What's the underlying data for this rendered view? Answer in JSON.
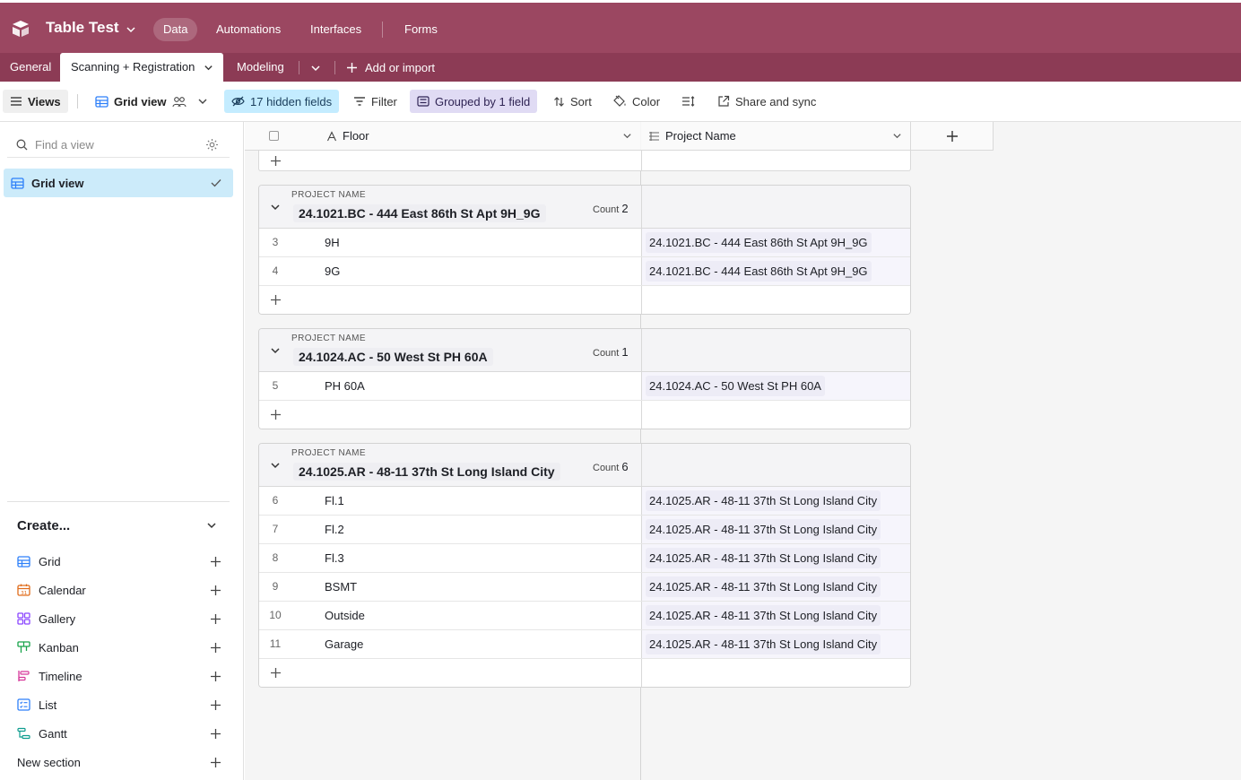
{
  "app": {
    "name": "Table Test"
  },
  "top_nav": [
    "Data",
    "Automations",
    "Interfaces",
    "Forms"
  ],
  "tables": {
    "tabs": [
      "General",
      "Scanning + Registration",
      "Modeling"
    ],
    "add_label": "Add or import"
  },
  "viewbar": {
    "views": "Views",
    "view_name": "Grid view",
    "hidden_fields": "17 hidden fields",
    "filter": "Filter",
    "grouped": "Grouped by 1 field",
    "sort": "Sort",
    "color": "Color",
    "share": "Share and sync"
  },
  "sidebar": {
    "find_placeholder": "Find a view",
    "active_view": "Grid view",
    "create_label": "Create...",
    "create_items": [
      "Grid",
      "Calendar",
      "Gallery",
      "Kanban",
      "Timeline",
      "List",
      "Gantt",
      "New section"
    ],
    "icon_colors": {
      "grid": "#2d7ff9",
      "calendar": "#e06c1b",
      "gallery": "#8b46ff",
      "kanban": "#18a34a",
      "timeline": "#d6389a",
      "list": "#2d7ff9",
      "gantt": "#0f9d8f"
    }
  },
  "grid": {
    "columns": [
      "Floor",
      "Project Name"
    ],
    "group_kicker": "PROJECT NAME",
    "count_label": "Count",
    "groups": [
      {
        "title": "24.1021.BC - 444 East 86th St Apt 9H_9G",
        "count": "2",
        "rows": [
          {
            "num": "3",
            "floor": "9H",
            "project": "24.1021.BC - 444 East 86th St Apt 9H_9G"
          },
          {
            "num": "4",
            "floor": "9G",
            "project": "24.1021.BC - 444 East 86th St Apt 9H_9G"
          }
        ]
      },
      {
        "title": "24.1024.AC - 50 West St PH 60A",
        "count": "1",
        "rows": [
          {
            "num": "5",
            "floor": "PH 60A",
            "project": "24.1024.AC - 50 West St PH 60A"
          }
        ]
      },
      {
        "title": "24.1025.AR - 48-11 37th St Long Island City",
        "count": "6",
        "rows": [
          {
            "num": "6",
            "floor": "Fl.1",
            "project": "24.1025.AR - 48-11 37th St Long Island City"
          },
          {
            "num": "7",
            "floor": "Fl.2",
            "project": "24.1025.AR - 48-11 37th St Long Island City"
          },
          {
            "num": "8",
            "floor": "Fl.3",
            "project": "24.1025.AR - 48-11 37th St Long Island City"
          },
          {
            "num": "9",
            "floor": "BSMT",
            "project": "24.1025.AR - 48-11 37th St Long Island City"
          },
          {
            "num": "10",
            "floor": "Outside",
            "project": "24.1025.AR - 48-11 37th St Long Island City"
          },
          {
            "num": "11",
            "floor": "Garage",
            "project": "24.1025.AR - 48-11 37th St Long Island City"
          }
        ]
      }
    ]
  },
  "colors": {
    "topbar": "#9b4761",
    "tabbar": "#8c3b55",
    "hidden_fields_bg": "#c4ecff",
    "grouped_bg": "#e0dbf4",
    "active_view_bg": "#ccebfa"
  }
}
